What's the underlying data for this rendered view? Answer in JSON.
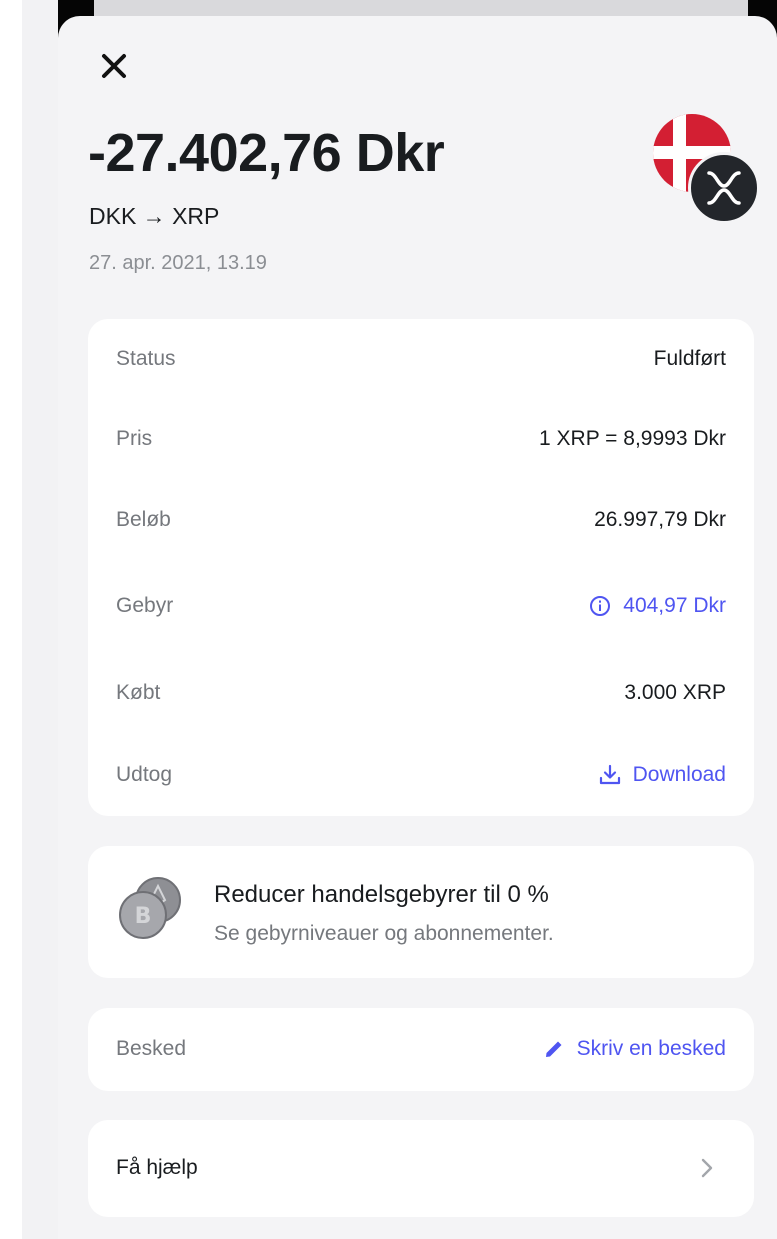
{
  "header": {
    "close_icon": "close-icon",
    "amount": "-27.402,76 Dkr",
    "pair": "DKK → XRP",
    "date": "27. apr. 2021, 13.19",
    "avatar_icons": [
      "denmark-flag-icon",
      "xrp-icon"
    ]
  },
  "details": {
    "rows": [
      {
        "label": "Status",
        "value": "Fuldført"
      },
      {
        "label": "Pris",
        "value": "1 XRP = 8,9993 Dkr"
      },
      {
        "label": "Beløb",
        "value": "26.997,79 Dkr"
      },
      {
        "label": "Gebyr",
        "value": "404,97 Dkr",
        "icon": "info-icon"
      },
      {
        "label": "Købt",
        "value": "3.000 XRP"
      },
      {
        "label": "Udtog",
        "value": "Download",
        "icon": "download-icon"
      }
    ]
  },
  "promo": {
    "title": "Reducer handelsgebyrer til 0 %",
    "subtitle": "Se gebyrniveauer og abonnementer.",
    "icon": "crypto-coins-icon"
  },
  "note": {
    "label": "Besked",
    "action": "Skriv en besked",
    "icon": "pencil-icon"
  },
  "help": {
    "label": "Få hjælp",
    "icon": "chevron-right-icon"
  },
  "colors": {
    "accent": "#4f55f1",
    "text": "#191c1f",
    "muted": "#75787d",
    "background": "#f4f4f6",
    "card": "#ffffff"
  }
}
